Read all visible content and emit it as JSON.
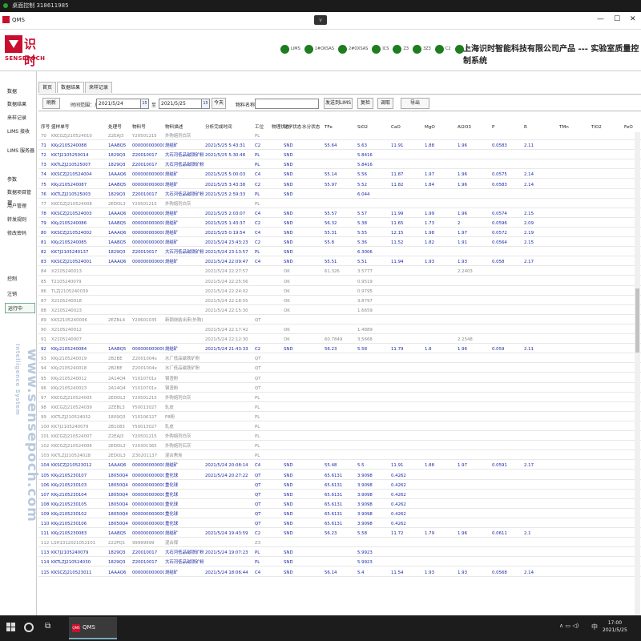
{
  "remote_bar": {
    "title": "桌面控制 318611985"
  },
  "remote_handle": "∨",
  "window": {
    "title": "QMS",
    "min": "—",
    "max": "☐",
    "close": "✕"
  },
  "logo": {
    "cn": "识时",
    "en": "SENSEPOCH"
  },
  "status_lights": [
    {
      "label": "LIMS"
    },
    {
      "label": "1#OXSAS"
    },
    {
      "label": "2#OXSAS"
    },
    {
      "label": "ICS"
    },
    {
      "label": "Z3"
    },
    {
      "label": "3Z3"
    },
    {
      "label": "C2"
    },
    {
      "label": "C4"
    }
  ],
  "company": "上海识时智能科技有限公司产品 --- 实验室质量控制系统",
  "sidebar": [
    {
      "label": "数据",
      "group": true
    },
    {
      "label": "数据结果"
    },
    {
      "label": "来样记录"
    },
    {
      "label": "LIMS 接收"
    },
    {
      "label": "LIMS 服务器"
    },
    {
      "label": "参数",
      "group": true
    },
    {
      "label": "数据项目管理"
    },
    {
      "label": "用户管理"
    },
    {
      "label": "转发规则"
    },
    {
      "label": "修改密码"
    },
    {
      "label": "控制",
      "group": true
    },
    {
      "label": "注销"
    },
    {
      "label": "运行中"
    }
  ],
  "watermark": {
    "url": "www.sensepoch.com",
    "tagline": "Intelligence System"
  },
  "tabs": [
    {
      "label": "首页"
    },
    {
      "label": "数据结果"
    },
    {
      "label": "来样记录"
    }
  ],
  "toolbar": {
    "refresh": "刷新",
    "time_range_label": "时间范围：从",
    "date_from": "2021/5/24",
    "to_label": "至",
    "date_to": "2021/5/25",
    "today": "今天",
    "material_label": "物料名称",
    "material_value": "",
    "send_lims": "发送到LIMS",
    "recheck": "复检",
    "retrieve": "调取",
    "export": "导出",
    "calendar_glyph": "15"
  },
  "columns": [
    "序号",
    "盛样单号",
    "处理号",
    "物料号",
    "物料描述",
    "分析完成时间",
    "工位",
    "物理状态",
    "化学状态",
    "水分状态",
    "TFe",
    "SiO2",
    "CaO",
    "MgO",
    "Al2O3",
    "P",
    "R",
    "TMn",
    "TiO2",
    "FeO"
  ],
  "rows": [
    {
      "c": "g",
      "v": [
        "70",
        "KKCGZJ210524010",
        "Z2EAJ3",
        "Y20501215",
        "外购熔剂白灰",
        "",
        "PL",
        "",
        "",
        "",
        "",
        "",
        "",
        "",
        "",
        "",
        "",
        "",
        "",
        ""
      ]
    },
    {
      "c": "b",
      "v": [
        "71",
        "KKy2105240088",
        "1AABQ5",
        "000000000000200",
        "烧结矿",
        "2021/5/25 5:43:31",
        "C2",
        "",
        "SND",
        "",
        "55.64",
        "5.63",
        "11.91",
        "1.88",
        "1.96",
        "0.0583",
        "2.11",
        "",
        "",
        ""
      ]
    },
    {
      "c": "b",
      "v": [
        "72",
        "KK7J2105250014",
        "1829Q3",
        "Z20010017",
        "大石河低品磁铁矿粉",
        "2021/5/25 5:30:48",
        "PL",
        "",
        "SND",
        "",
        "",
        "5.8416",
        "",
        "",
        "",
        "",
        "",
        "",
        "",
        ""
      ]
    },
    {
      "c": "b",
      "v": [
        "73",
        "KKTLZJ210525007",
        "1829Q3",
        "Z20010017",
        "大石河低品磁铁矿粉",
        "",
        "PL",
        "",
        "SND",
        "",
        "",
        "5.8416",
        "",
        "",
        "",
        "",
        "",
        "",
        "",
        ""
      ]
    },
    {
      "c": "b",
      "v": [
        "74",
        "KKSCZJ210524004",
        "1AAAQ6",
        "000000000000200",
        "烧结矿",
        "2021/5/25 5:00:03",
        "C4",
        "",
        "SND",
        "",
        "55.14",
        "5.56",
        "11.87",
        "1.97",
        "1.96",
        "0.0575",
        "2.14",
        "",
        "",
        ""
      ]
    },
    {
      "c": "b",
      "v": [
        "75",
        "KKy2105240087",
        "1AABQ5",
        "000000000000200",
        "烧结矿",
        "2021/5/25 3:43:38",
        "C2",
        "",
        "SND",
        "",
        "55.97",
        "5.52",
        "11.82",
        "1.84",
        "1.96",
        "0.0583",
        "2.14",
        "",
        "",
        ""
      ]
    },
    {
      "c": "b",
      "v": [
        "76",
        "KKTLZJ210525003",
        "1829Q3",
        "Z20010017",
        "大石河低品磁铁矿粉",
        "2021/5/25 2:59:33",
        "PL",
        "",
        "SND",
        "",
        "",
        "6.044",
        "",
        "",
        "",
        "",
        "",
        "",
        "",
        ""
      ]
    },
    {
      "c": "g",
      "v": [
        "77",
        "KKCGZJ210524008",
        "2EDOL3",
        "Y20501215",
        "外购熔剂白灰",
        "",
        "PL",
        "",
        "",
        "",
        "",
        "",
        "",
        "",
        "",
        "",
        "",
        "",
        "",
        ""
      ]
    },
    {
      "c": "b",
      "v": [
        "78",
        "KKSCZJ210524003",
        "1AAAQ6",
        "000000000000200",
        "烧结矿",
        "2021/5/25 2:03:07",
        "C4",
        "",
        "SND",
        "",
        "55.57",
        "5.57",
        "11.99",
        "1.99",
        "1.96",
        "0.0574",
        "2.15",
        "",
        "",
        ""
      ]
    },
    {
      "c": "b",
      "v": [
        "79",
        "KKy2105240086",
        "1AABQ5",
        "000000000000200",
        "烧结矿",
        "2021/5/25 1:43:37",
        "C2",
        "",
        "SND",
        "",
        "56.32",
        "5.38",
        "11.65",
        "1.73",
        "2",
        "0.0596",
        "2.09",
        "",
        "",
        ""
      ]
    },
    {
      "c": "b",
      "v": [
        "80",
        "KKSCZJ210524002",
        "1AAAQ6",
        "000000000000200",
        "烧结矿",
        "2021/5/25 0:19:54",
        "C4",
        "",
        "SND",
        "",
        "55.31",
        "5.55",
        "12.15",
        "1.98",
        "1.97",
        "0.0572",
        "2.19",
        "",
        "",
        ""
      ]
    },
    {
      "c": "b",
      "v": [
        "81",
        "KKy2105240085",
        "1AABQ5",
        "000000000000200",
        "烧结矿",
        "2021/5/24 23:43:23",
        "C2",
        "",
        "SND",
        "",
        "55.8",
        "5.36",
        "11.52",
        "1.82",
        "1.91",
        "0.0564",
        "2.15",
        "",
        "",
        ""
      ]
    },
    {
      "c": "b",
      "v": [
        "82",
        "KK7J2105240137",
        "1829Q3",
        "Z20010017",
        "大石河低品磁铁矿粉",
        "2021/5/24 23:13:57",
        "PL",
        "",
        "SND",
        "",
        "",
        "6.3006",
        "",
        "",
        "",
        "",
        "",
        "",
        "",
        ""
      ]
    },
    {
      "c": "b",
      "v": [
        "83",
        "KKSCZJ210524001",
        "1AAAQ6",
        "000000000000200",
        "烧结矿",
        "2021/5/24 22:09:47",
        "C4",
        "",
        "SND",
        "",
        "55.51",
        "5.51",
        "11.94",
        "1.93",
        "1.93",
        "0.058",
        "2.17",
        "",
        "",
        ""
      ]
    },
    {
      "c": "g",
      "v": [
        "84",
        "X2105240013",
        "",
        "",
        "",
        "2021/5/24 22:27:57",
        "",
        "",
        "OK",
        "",
        "61.326",
        "3.5777",
        "",
        "",
        "2.2403",
        "",
        "",
        "",
        "",
        ""
      ]
    },
    {
      "c": "g",
      "v": [
        "85",
        "T2105240079",
        "",
        "",
        "",
        "2021/5/24 22:25:56",
        "",
        "",
        "OK",
        "",
        "",
        "0.9519",
        "",
        "",
        "",
        "",
        "",
        "",
        "",
        ""
      ]
    },
    {
      "c": "g",
      "v": [
        "86",
        "TLZJ2105240039",
        "",
        "",
        "",
        "2021/5/24 22:24:02",
        "",
        "",
        "OK",
        "",
        "",
        "0.9795",
        "",
        "",
        "",
        "",
        "",
        "",
        "",
        ""
      ]
    },
    {
      "c": "g",
      "v": [
        "87",
        "X2105240018",
        "",
        "",
        "",
        "2021/5/24 22:18:55",
        "",
        "",
        "OK",
        "",
        "",
        "3.8797",
        "",
        "",
        "",
        "",
        "",
        "",
        "",
        ""
      ]
    },
    {
      "c": "g",
      "v": [
        "88",
        "X2105240023",
        "",
        "",
        "",
        "2021/5/24 22:15:30",
        "",
        "",
        "OK",
        "",
        "",
        "1.6659",
        "",
        "",
        "",
        "",
        "",
        "",
        "",
        ""
      ]
    },
    {
      "c": "g",
      "v": [
        "89",
        "KKS2105240006",
        "2EZNL4",
        "Y20601035",
        "新钢烧结出来(外购)",
        "",
        "QT",
        "",
        "",
        "",
        "",
        "",
        "",
        "",
        "",
        "",
        "",
        "",
        "",
        ""
      ]
    },
    {
      "c": "g",
      "v": [
        "90",
        "X2105240012",
        "",
        "",
        "",
        "2021/5/24 22:17:42",
        "",
        "",
        "OK",
        "",
        "",
        "1.4889",
        "",
        "",
        "",
        "",
        "",
        "",
        "",
        ""
      ]
    },
    {
      "c": "g",
      "v": [
        "91",
        "X2105240007",
        "",
        "",
        "",
        "2021/5/24 22:12:30",
        "",
        "",
        "OK",
        "",
        "60.7849",
        "3.5668",
        "",
        "",
        "2.2548",
        "",
        "",
        "",
        "",
        ""
      ]
    },
    {
      "c": "b",
      "v": [
        "92",
        "KKy2105240084",
        "1AABQ5",
        "000000000000200",
        "烧结矿",
        "2021/5/24 21:43:33",
        "C2",
        "",
        "SND",
        "",
        "56.23",
        "5.58",
        "11.79",
        "1.8",
        "1.96",
        "0.059",
        "2.11",
        "",
        "",
        ""
      ]
    },
    {
      "c": "g",
      "v": [
        "93",
        "KKy2105240019",
        "2B2BE",
        "Z2001004x",
        "水厂低品磁铁矿粉",
        "",
        "QT",
        "",
        "",
        "",
        "",
        "",
        "",
        "",
        "",
        "",
        "",
        "",
        "",
        ""
      ]
    },
    {
      "c": "g",
      "v": [
        "94",
        "KKy2105240018",
        "2B2BE",
        "Z2001004x",
        "水厂低品磁铁矿粉",
        "",
        "QT",
        "",
        "",
        "",
        "",
        "",
        "",
        "",
        "",
        "",
        "",
        "",
        "",
        ""
      ]
    },
    {
      "c": "g",
      "v": [
        "95",
        "KKy2105240012",
        "2A14Q4",
        "Y1010701x",
        "钢渣粉",
        "",
        "QT",
        "",
        "",
        "",
        "",
        "",
        "",
        "",
        "",
        "",
        "",
        "",
        "",
        ""
      ]
    },
    {
      "c": "g",
      "v": [
        "96",
        "KKy2105240023",
        "2A14Q4",
        "Y1010701x",
        "钢渣粉",
        "",
        "QT",
        "",
        "",
        "",
        "",
        "",
        "",
        "",
        "",
        "",
        "",
        "",
        "",
        ""
      ]
    },
    {
      "c": "g",
      "v": [
        "97",
        "KKCGZJ210524005",
        "2EDOL3",
        "Y20501215",
        "外购熔剂白灰",
        "",
        "PL",
        "",
        "",
        "",
        "",
        "",
        "",
        "",
        "",
        "",
        "",
        "",
        "",
        ""
      ]
    },
    {
      "c": "g",
      "v": [
        "98",
        "KKCGZJ210524039",
        "2ZEBL3",
        "Y50013027",
        "轧皮",
        "",
        "PL",
        "",
        "",
        "",
        "",
        "",
        "",
        "",
        "",
        "",
        "",
        "",
        "",
        ""
      ]
    },
    {
      "c": "g",
      "v": [
        "99",
        "KKTLZJ210524032",
        "1809Q3",
        "Y10106127",
        "P8粉",
        "",
        "PL",
        "",
        "",
        "",
        "",
        "",
        "",
        "",
        "",
        "",
        "",
        "",
        "",
        ""
      ]
    },
    {
      "c": "g",
      "v": [
        "100",
        "KK7J2105240079",
        "2B1083",
        "Y50013027",
        "轧皮",
        "",
        "PL",
        "",
        "",
        "",
        "",
        "",
        "",
        "",
        "",
        "",
        "",
        "",
        "",
        ""
      ]
    },
    {
      "c": "g",
      "v": [
        "101",
        "KKCGZJ210524007",
        "Z2EAJ3",
        "Y20501215",
        "外购熔剂白灰",
        "",
        "PL",
        "",
        "",
        "",
        "",
        "",
        "",
        "",
        "",
        "",
        "",
        "",
        "",
        ""
      ]
    },
    {
      "c": "g",
      "v": [
        "102",
        "KKCGZJ210524006",
        "2EDOL3",
        "Y20301365",
        "外购熔剂石灰",
        "",
        "PL",
        "",
        "",
        "",
        "",
        "",
        "",
        "",
        "",
        "",
        "",
        "",
        "",
        ""
      ]
    },
    {
      "c": "g",
      "v": [
        "103",
        "KKTLZJ210524028",
        "2EDOL3",
        "Z30201137",
        "混合焦炭",
        "",
        "PL",
        "",
        "",
        "",
        "",
        "",
        "",
        "",
        "",
        "",
        "",
        "",
        "",
        ""
      ]
    },
    {
      "c": "b",
      "v": [
        "104",
        "KKSCZJ210523012",
        "1AAAQ6",
        "000000000000200",
        "烧结矿",
        "2021/5/24 20:08:14",
        "C4",
        "",
        "SND",
        "",
        "55.48",
        "5.5",
        "11.91",
        "1.88",
        "1.97",
        "0.0591",
        "2.17",
        "",
        "",
        ""
      ]
    },
    {
      "c": "b",
      "v": [
        "105",
        "KKy2105230107",
        "18050Q4",
        "000000000000200",
        "重化球",
        "2021/5/24 20:27:22",
        "QT",
        "",
        "SND",
        "",
        "65.6131",
        "3.9098",
        "0.4262",
        "",
        "",
        "",
        "",
        "",
        "",
        ""
      ]
    },
    {
      "c": "b",
      "v": [
        "106",
        "KKy2105230103",
        "18050Q4",
        "000000000000200",
        "重化球",
        "",
        "QT",
        "",
        "SND",
        "",
        "65.6131",
        "3.9098",
        "0.4262",
        "",
        "",
        "",
        "",
        "",
        "",
        ""
      ]
    },
    {
      "c": "b",
      "v": [
        "107",
        "KKy2105230104",
        "18050Q4",
        "000000000000200",
        "重化球",
        "",
        "QT",
        "",
        "SND",
        "",
        "65.6131",
        "3.9098",
        "0.4262",
        "",
        "",
        "",
        "",
        "",
        "",
        ""
      ]
    },
    {
      "c": "b",
      "v": [
        "108",
        "KKy2105230105",
        "18050Q4",
        "000000000000200",
        "重化球",
        "",
        "QT",
        "",
        "SND",
        "",
        "65.6131",
        "3.9098",
        "0.4262",
        "",
        "",
        "",
        "",
        "",
        "",
        ""
      ]
    },
    {
      "c": "b",
      "v": [
        "109",
        "KKy2105230102",
        "18050Q4",
        "000000000000200",
        "重化球",
        "",
        "QT",
        "",
        "SND",
        "",
        "65.6131",
        "3.9098",
        "0.4262",
        "",
        "",
        "",
        "",
        "",
        "",
        ""
      ]
    },
    {
      "c": "b",
      "v": [
        "110",
        "KKy2105230106",
        "18050Q4",
        "000000000000200",
        "重化球",
        "",
        "QT",
        "",
        "SND",
        "",
        "65.6131",
        "3.9098",
        "0.4262",
        "",
        "",
        "",
        "",
        "",
        "",
        ""
      ]
    },
    {
      "c": "b",
      "v": [
        "111",
        "KKy2105230083",
        "1AABQ5",
        "000000000000200",
        "烧结矿",
        "2021/5/24 19:43:59",
        "C2",
        "",
        "SND",
        "",
        "56.23",
        "5.58",
        "11.72",
        "1.79",
        "1.96",
        "0.0611",
        "2.1",
        "",
        "",
        ""
      ]
    },
    {
      "c": "g",
      "v": [
        "112",
        "LSH1312021052101",
        "222PQ1",
        "99999999",
        "混合煤",
        "",
        "Z3",
        "",
        "",
        "",
        "",
        "",
        "",
        "",
        "",
        "",
        "",
        "",
        "",
        ""
      ]
    },
    {
      "c": "b",
      "v": [
        "113",
        "KK7J2105240079",
        "1829Q3",
        "Z20010017",
        "大石河低品磁铁矿粉",
        "2021/5/24 19:07:23",
        "PL",
        "",
        "SND",
        "",
        "",
        "5.9923",
        "",
        "",
        "",
        "",
        "",
        "",
        "",
        ""
      ]
    },
    {
      "c": "b",
      "v": [
        "114",
        "KKTLZJ210524030",
        "1829Q3",
        "Z20010017",
        "大石河低品磁铁矿粉",
        "",
        "PL",
        "",
        "SND",
        "",
        "",
        "5.9923",
        "",
        "",
        "",
        "",
        "",
        "",
        "",
        ""
      ]
    },
    {
      "c": "b",
      "v": [
        "115",
        "KKSCZJ210523011",
        "1AAAQ6",
        "000000000000200",
        "烧结矿",
        "2021/5/24 18:06:44",
        "C4",
        "",
        "SND",
        "",
        "56.14",
        "5.4",
        "11.54",
        "1.93",
        "1.93",
        "0.0568",
        "2.14",
        "",
        "",
        ""
      ]
    }
  ],
  "taskbar": {
    "task_label": "QMS",
    "task_icon": "QMS",
    "time": "17:00",
    "date": "2021/5/25",
    "ime": "中",
    "search": "○",
    "view": "⧉",
    "tray": "∧ ▭ ◁)"
  }
}
